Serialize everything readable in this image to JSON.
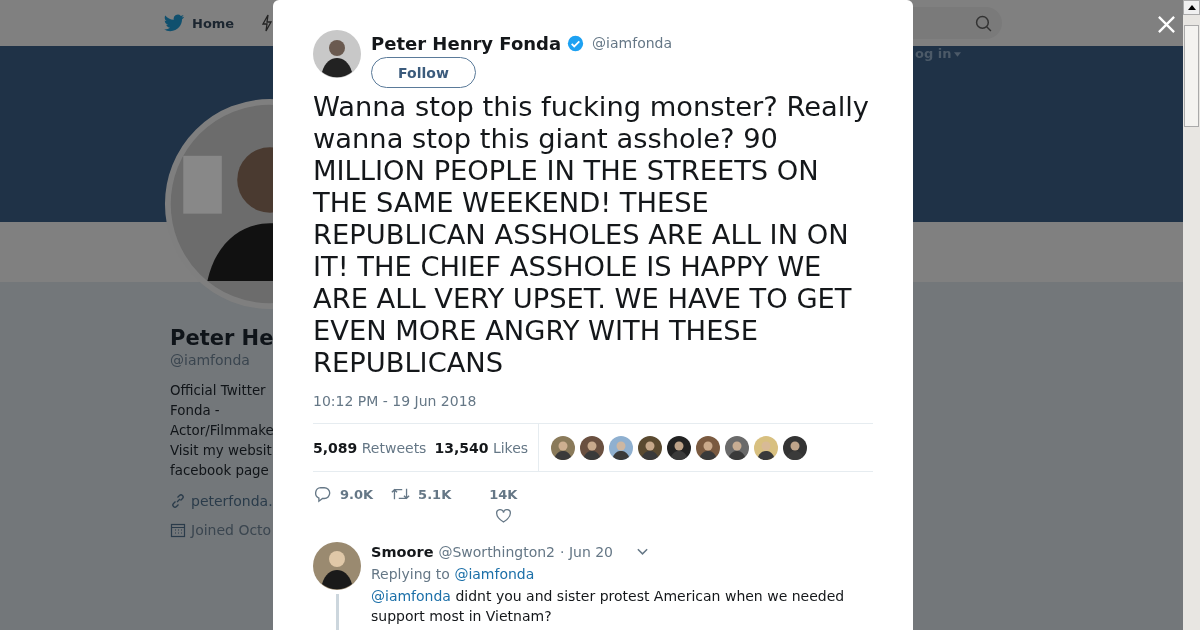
{
  "background_page": {
    "nav": {
      "home_label": "Home",
      "login_label": "og in"
    },
    "profile": {
      "name": "Peter He",
      "handle": "@iamfonda",
      "bio_lines": [
        "Official Twitter",
        "Fonda -",
        "Actor/Filmmake",
        "Visit my websit",
        "facebook page"
      ],
      "website": "peterfonda.",
      "joined": "Joined Octo"
    }
  },
  "tweet": {
    "author": {
      "name": "Peter Henry Fonda",
      "handle": "@iamfonda",
      "verified": true
    },
    "follow_label": "Follow",
    "text": "Wanna stop this fucking monster? Really wanna stop this giant asshole? 90 MILLION PEOPLE IN THE STREETS ON THE SAME WEEKEND! THESE REPUBLICAN ASSHOLES ARE ALL IN ON IT! THE CHIEF ASSHOLE IS HAPPY WE ARE ALL VERY UPSET. WE HAVE TO GET EVEN MORE ANGRY WITH THESE REPUBLICANS",
    "timestamp": "10:12 PM - 19 Jun 2018",
    "stats": [
      {
        "count": "5,089",
        "label": "Retweets"
      },
      {
        "count": "13,540",
        "label": "Likes"
      }
    ],
    "actions": [
      {
        "kind": "reply",
        "count": "9.0K"
      },
      {
        "kind": "retweet",
        "count": "5.1K"
      },
      {
        "kind": "like",
        "count": "14K"
      }
    ]
  },
  "replies": [
    {
      "name": "Smoore",
      "handle": "@Sworthington2",
      "date": "· Jun 20",
      "replying_to_label": "Replying to",
      "replying_to": "@iamfonda",
      "mention": "@iamfonda",
      "text": "didnt you and sister protest American when we needed support most in Vietnam?"
    }
  ]
}
